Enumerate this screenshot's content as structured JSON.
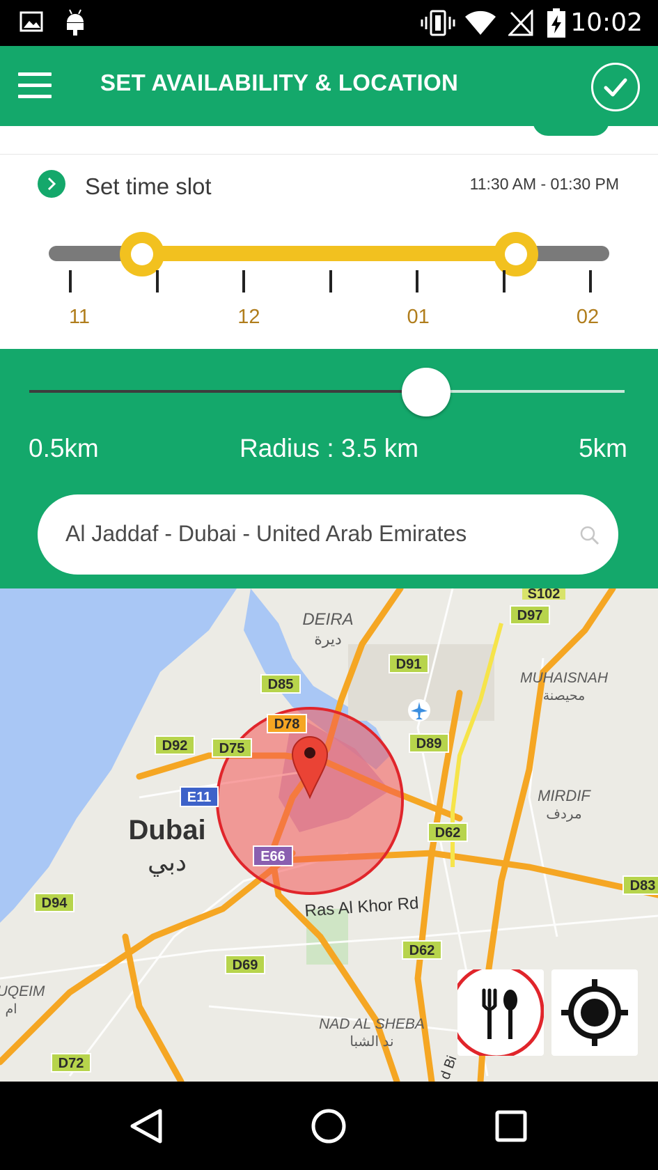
{
  "status_bar": {
    "time": "10:02",
    "icons": [
      "image-icon",
      "android-icon",
      "vibrate-icon",
      "wifi-icon",
      "no-signal-icon",
      "battery-charging-icon"
    ]
  },
  "app_bar": {
    "title": "SET AVAILABILITY & LOCATION",
    "menu_icon": "hamburger-menu-icon",
    "confirm_icon": "check-circle-icon",
    "background": "#14a86b"
  },
  "time_slot": {
    "label": "Set time slot",
    "value": "11:30 AM - 01:30 PM",
    "tick_labels": [
      "11",
      "12",
      "01",
      "02"
    ],
    "range_start_fraction": 0.1667,
    "range_end_fraction": 0.8333,
    "fill_color": "#f2c11f"
  },
  "radius": {
    "min_label": "0.5km",
    "max_label": "5km",
    "current_label": "Radius : 3.5 km",
    "min_km": 0.5,
    "max_km": 5,
    "value_km": 3.5
  },
  "search": {
    "value": "Al Jaddaf - Dubai - United Arab Emirates",
    "icon": "search-icon"
  },
  "map": {
    "labels": {
      "deira": "DEIRA",
      "deira_ar": "ديرة",
      "muhaisnah": "MUHAISNAH",
      "muhaisnah_ar": "محيصنة",
      "mirdif": "MIRDIF",
      "mirdif_ar": "مردف",
      "dubai": "Dubai",
      "dubai_ar": "دبي",
      "ras_al_khor": "Ras Al Khor Rd",
      "nad_al_sheba": "NAD AL SHEBA",
      "nad_al_sheba_ar": "ند الشبا",
      "uqeim": "UQEIM",
      "uqeim_ar": "ام",
      "bi": "d Bi"
    },
    "road_shields": [
      "S102",
      "D97",
      "D91",
      "D85",
      "D78",
      "D92",
      "D75",
      "D89",
      "E11",
      "D62",
      "E66",
      "D94",
      "D62",
      "D69",
      "D72",
      "D83"
    ],
    "pin_icon": "map-pin-icon",
    "airport_icon": "airport-icon",
    "restaurant_button_icon": "fork-spoon-icon",
    "locate_button_icon": "crosshair-target-icon"
  },
  "nav_bar": {
    "icons": [
      "back-triangle-icon",
      "home-circle-icon",
      "recents-square-icon"
    ]
  }
}
